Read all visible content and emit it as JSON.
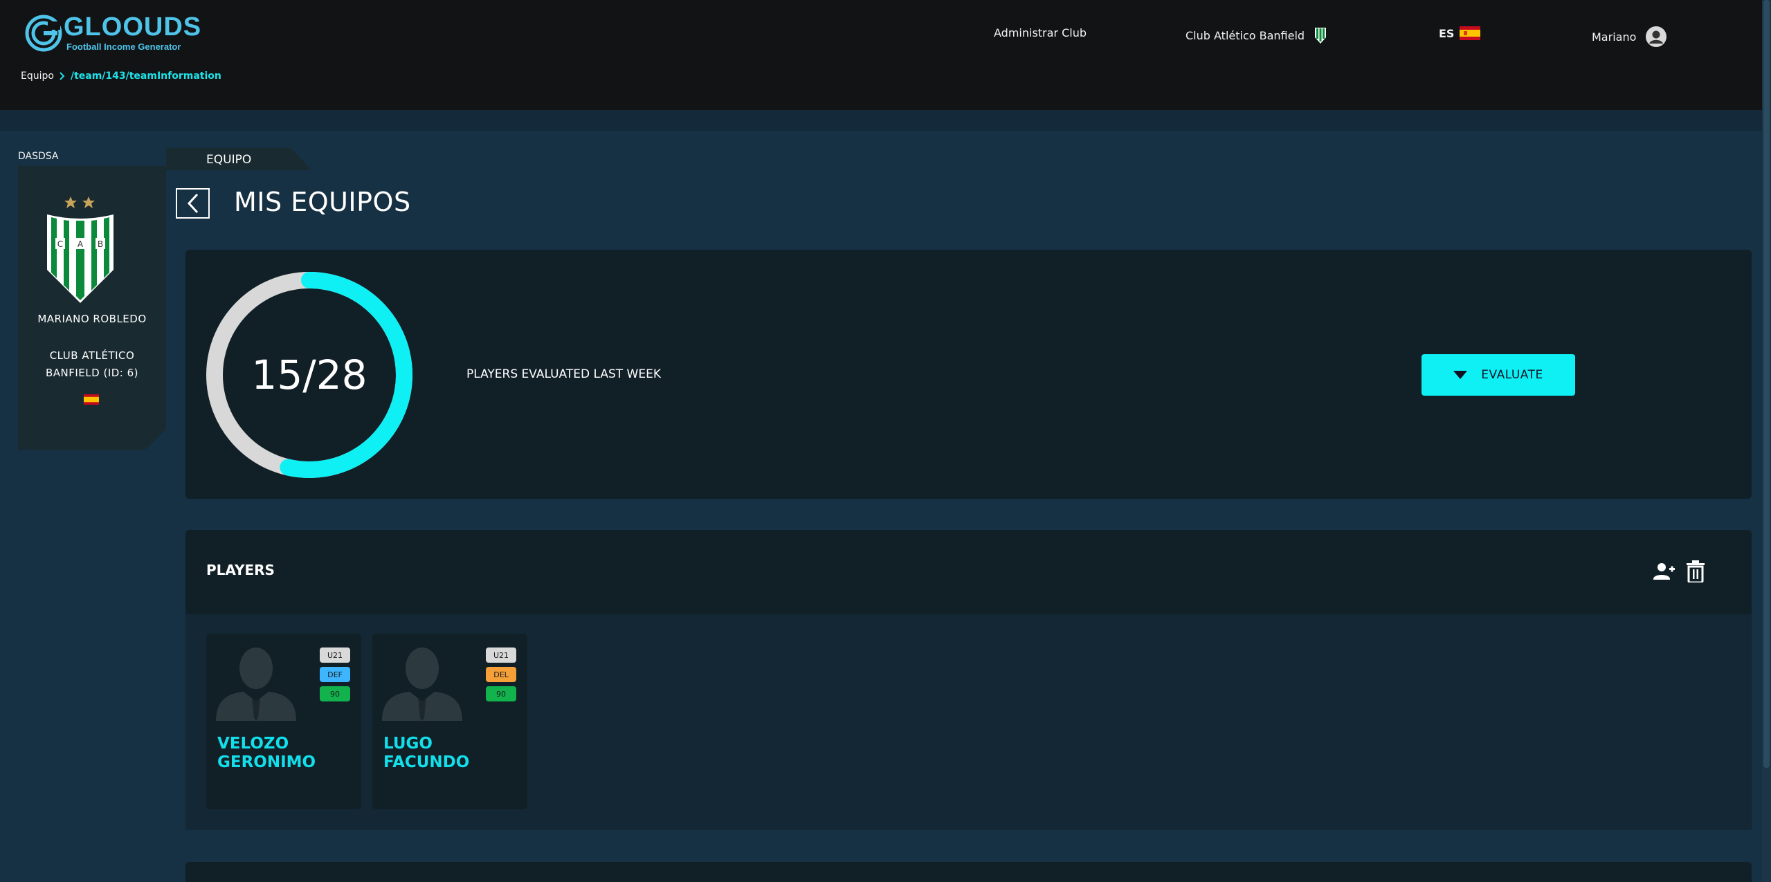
{
  "header": {
    "logo_title": "GLOOUDS",
    "logo_subtitle": "Football Income Generator",
    "nav_admin": "Administrar Club",
    "nav_club": "Club Atlético Banfield",
    "nav_lang": "ES",
    "nav_user": "Mariano"
  },
  "breadcrumb": {
    "root": "Equipo",
    "path": "/team/143/teamInformation"
  },
  "profile": {
    "user_tag": "DASDSA",
    "name": "MARIANO ROBLEDO",
    "club": "CLUB ATLÉTICO BANFIELD (ID: 6)",
    "crest_letters": [
      "C",
      "A",
      "B"
    ]
  },
  "tab": {
    "label": "EQUIPO"
  },
  "page": {
    "title": "MIS EQUIPOS"
  },
  "stats": {
    "evaluated": 15,
    "total": 28,
    "display": "15/28",
    "label": "PLAYERS EVALUATED LAST WEEK",
    "evaluate_label": "EVALUATE"
  },
  "players_section": {
    "title": "PLAYERS"
  },
  "players": [
    {
      "name": "VELOZO GERONIMO",
      "badges": [
        {
          "text": "U21",
          "color": "#d9d9d9"
        },
        {
          "text": "DEF",
          "color": "#3db6ff"
        },
        {
          "text": "90",
          "color": "#12b24d"
        }
      ]
    },
    {
      "name": "LUGO FACUNDO",
      "badges": [
        {
          "text": "U21",
          "color": "#d9d9d9"
        },
        {
          "text": "DEL",
          "color": "#f5a038"
        },
        {
          "text": "90",
          "color": "#12b24d"
        }
      ]
    }
  ],
  "colors": {
    "accent": "#0ff0f5",
    "ring_track": "#d8d8d8",
    "background": "#163144"
  }
}
